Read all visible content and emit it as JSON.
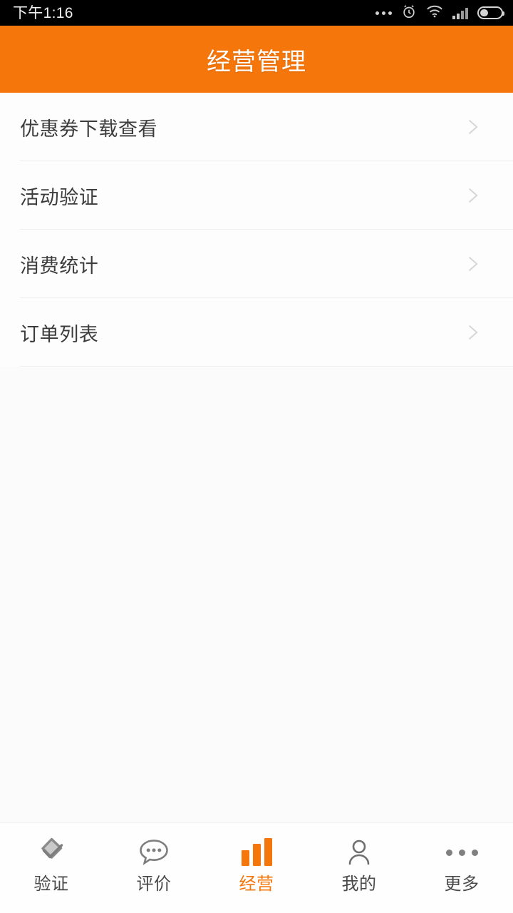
{
  "status_bar": {
    "time": "下午1:16",
    "icons": [
      {
        "name": "more-dots-icon"
      },
      {
        "name": "alarm-clock-icon"
      },
      {
        "name": "wifi-icon"
      },
      {
        "name": "cellular-signal-icon"
      },
      {
        "name": "battery-icon"
      }
    ]
  },
  "header": {
    "title": "经营管理",
    "background_color": "#f5760b",
    "text_color": "#ffffff"
  },
  "list": {
    "items": [
      {
        "label": "优惠券下载查看",
        "chevron": "chevron-right-icon"
      },
      {
        "label": "活动验证",
        "chevron": "chevron-right-icon"
      },
      {
        "label": "消费统计",
        "chevron": "chevron-right-icon"
      },
      {
        "label": "订单列表",
        "chevron": "chevron-right-icon"
      }
    ]
  },
  "tabbar": {
    "active_color": "#f5760b",
    "inactive_color": "#4a4a4a",
    "tabs": [
      {
        "label": "验证",
        "icon": "verify-check-badge-icon",
        "active": false
      },
      {
        "label": "评价",
        "icon": "speech-bubble-dots-icon",
        "active": false
      },
      {
        "label": "经营",
        "icon": "bar-chart-icon",
        "active": true
      },
      {
        "label": "我的",
        "icon": "person-icon",
        "active": false
      },
      {
        "label": "更多",
        "icon": "more-dots-icon",
        "active": false
      }
    ]
  }
}
